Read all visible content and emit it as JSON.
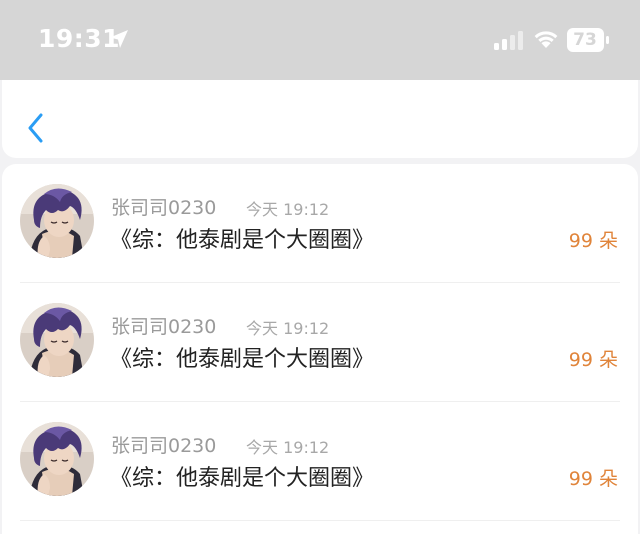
{
  "status_bar": {
    "time": "19:31",
    "battery": "73",
    "icons": [
      "location-arrow-icon",
      "signal-icon",
      "wifi-icon",
      "battery-icon"
    ]
  },
  "nav": {
    "back_icon": "chevron-left-icon",
    "accent_color": "#2a9df4"
  },
  "rows": [
    {
      "username": "张司司0230",
      "time": "今天 19:12",
      "title": "《综：他泰剧是个大圈圈》",
      "amount": "99 朵"
    },
    {
      "username": "张司司0230",
      "time": "今天 19:12",
      "title": "《综：他泰剧是个大圈圈》",
      "amount": "99 朵"
    },
    {
      "username": "张司司0230",
      "time": "今天 19:12",
      "title": "《综：他泰剧是个大圈圈》",
      "amount": "99 朵"
    }
  ],
  "colors": {
    "amount": "#e0843a",
    "status_bar_bg": "#d6d6d6"
  }
}
